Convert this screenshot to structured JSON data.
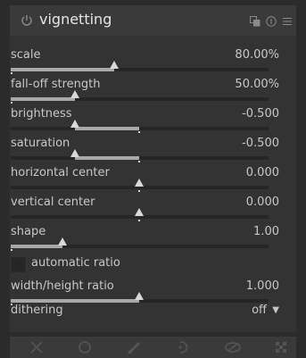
{
  "module": {
    "title": "vignetting",
    "sliders": [
      {
        "label": "scale",
        "value": "80.00%",
        "fraction": 0.4
      },
      {
        "label": "fall-off strength",
        "value": "50.00%",
        "fraction": 0.25
      },
      {
        "label": "brightness",
        "value": "-0.500",
        "fraction": 0.25
      },
      {
        "label": "saturation",
        "value": "-0.500",
        "fraction": 0.25
      },
      {
        "label": "horizontal center",
        "value": "0.000",
        "fraction": 0.5
      },
      {
        "label": "vertical center",
        "value": "0.000",
        "fraction": 0.5
      },
      {
        "label": "shape",
        "value": "1.00",
        "fraction": 0.2
      }
    ],
    "checkbox": {
      "label": "automatic ratio",
      "checked": false
    },
    "ratio_slider": {
      "label": "width/height ratio",
      "value": "1.000",
      "fraction": 0.5
    },
    "dithering": {
      "label": "dithering",
      "value": "off"
    }
  },
  "toolbar": {
    "icons": [
      "close-icon",
      "circle-icon",
      "brush-icon",
      "path-icon",
      "gradient-icon",
      "checker-icon"
    ]
  }
}
